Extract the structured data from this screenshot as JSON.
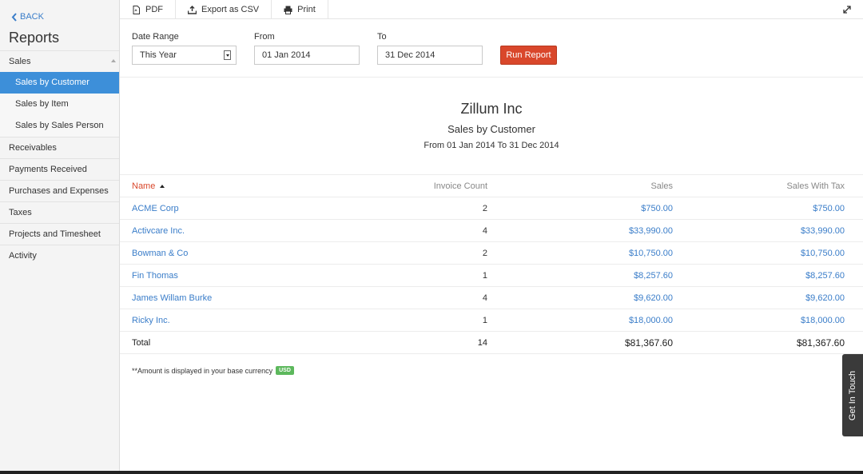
{
  "sidebar": {
    "back_label": "BACK",
    "title": "Reports",
    "items": [
      {
        "label": "Sales"
      },
      {
        "label": "Sales by Customer"
      },
      {
        "label": "Sales by Item"
      },
      {
        "label": "Sales by Sales Person"
      },
      {
        "label": "Receivables"
      },
      {
        "label": "Payments Received"
      },
      {
        "label": "Purchases and Expenses"
      },
      {
        "label": "Taxes"
      },
      {
        "label": "Projects and Timesheet"
      },
      {
        "label": "Activity"
      }
    ]
  },
  "toolbar": {
    "pdf_label": "PDF",
    "csv_label": "Export as CSV",
    "print_label": "Print"
  },
  "filters": {
    "date_range_label": "Date Range",
    "date_range_value": "This Year",
    "from_label": "From",
    "from_value": "01 Jan 2014",
    "to_label": "To",
    "to_value": "31 Dec 2014",
    "run_label": "Run Report"
  },
  "report": {
    "company": "Zillum Inc",
    "name": "Sales by Customer",
    "range": "From 01 Jan 2014 To 31 Dec 2014",
    "columns": {
      "name": "Name",
      "invoice_count": "Invoice Count",
      "sales": "Sales",
      "sales_with_tax": "Sales With Tax"
    },
    "rows": [
      {
        "name": "ACME Corp",
        "count": "2",
        "sales": "$750.00",
        "tax": "$750.00"
      },
      {
        "name": "Activcare Inc.",
        "count": "4",
        "sales": "$33,990.00",
        "tax": "$33,990.00"
      },
      {
        "name": "Bowman & Co",
        "count": "2",
        "sales": "$10,750.00",
        "tax": "$10,750.00"
      },
      {
        "name": "Fin Thomas",
        "count": "1",
        "sales": "$8,257.60",
        "tax": "$8,257.60"
      },
      {
        "name": "James Willam Burke",
        "count": "4",
        "sales": "$9,620.00",
        "tax": "$9,620.00"
      },
      {
        "name": "Ricky Inc.",
        "count": "1",
        "sales": "$18,000.00",
        "tax": "$18,000.00"
      }
    ],
    "total": {
      "label": "Total",
      "count": "14",
      "sales": "$81,367.60",
      "tax": "$81,367.60"
    }
  },
  "footnote": {
    "text": "**Amount is displayed in your base currency",
    "badge": "USD"
  },
  "get_in_touch": "Get In Touch",
  "colors": {
    "accent": "#3d8fd9",
    "link": "#3a7dc9",
    "run_button": "#d9472b",
    "usd_badge": "#5cb85c"
  }
}
